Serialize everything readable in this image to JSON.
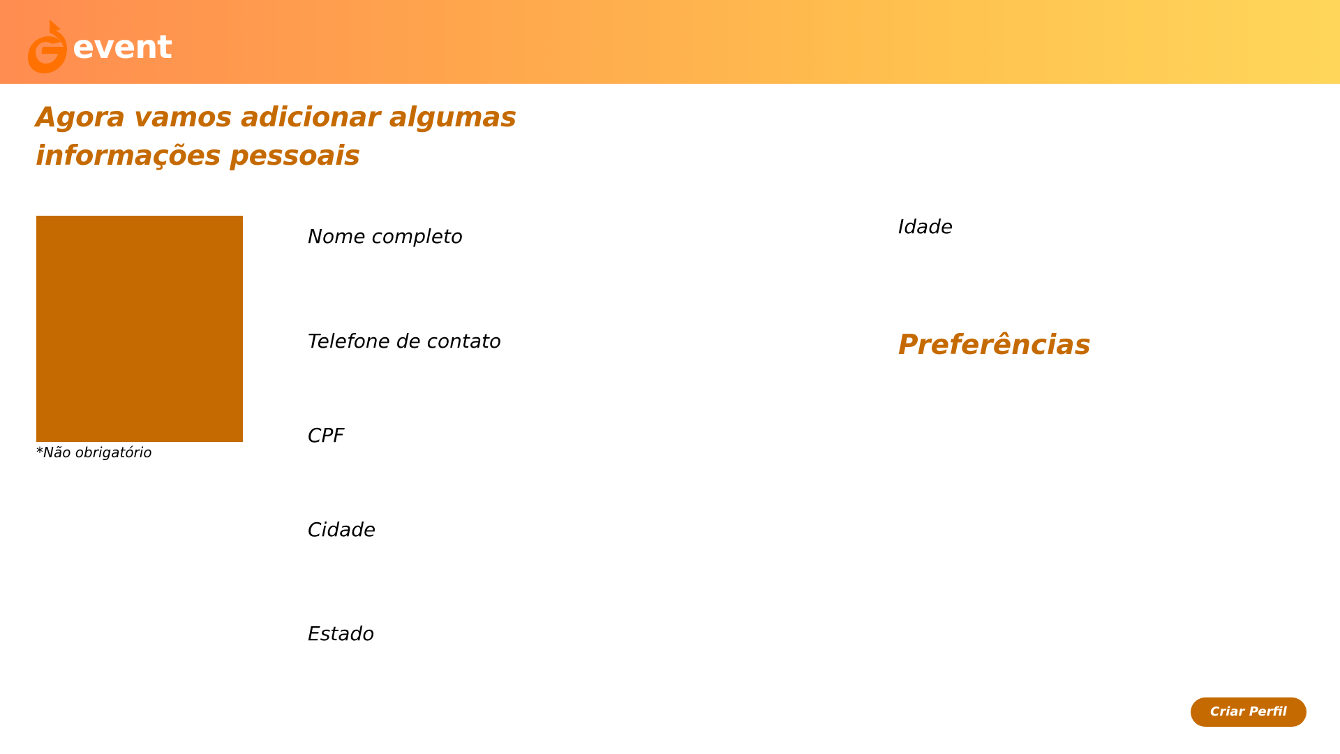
{
  "header": {
    "logo_text": "event",
    "logo_icon": "event-logo-icon",
    "gradient_colors": [
      "#ff8c50",
      "#ffa64d",
      "#ffc24f",
      "#ffd65a"
    ]
  },
  "main": {
    "title": "Agora vamos adicionar algumas informações pessoais",
    "photo_note": "*Não obrigatório",
    "fields": {
      "full_name_label": "Nome completo",
      "phone_label": "Telefone de contato",
      "cpf_label": "CPF",
      "city_label": "Cidade",
      "state_label": "Estado",
      "age_label": "Idade"
    },
    "preferences_title": "Preferências",
    "create_profile_button": "Criar Perfil"
  },
  "colors": {
    "accent": "#c56a00",
    "logo_mark": "#ff7100",
    "background": "#ffffff"
  }
}
